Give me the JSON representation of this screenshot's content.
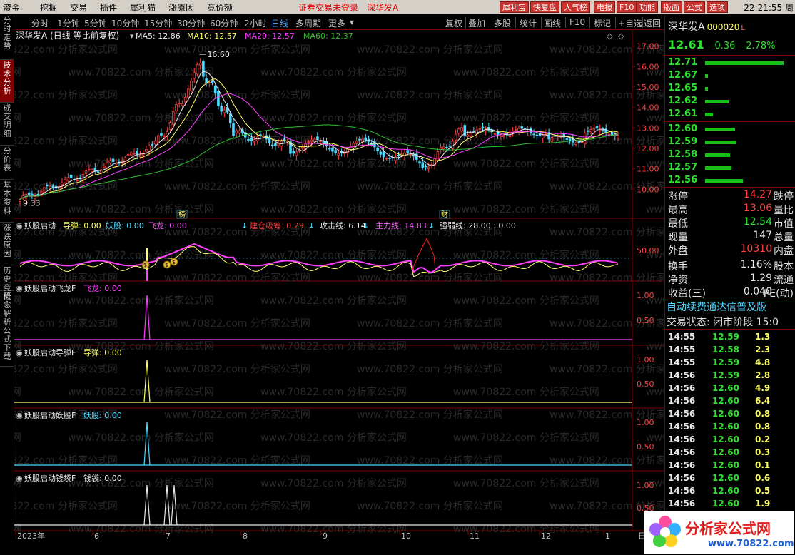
{
  "menu": {
    "items": [
      "资金",
      "挖掘",
      "交易",
      "插件",
      "犀利猫",
      "涨原因",
      "竞价额"
    ],
    "notice": "证券交易未登录",
    "notice_stock": "深华发A",
    "red_buttons": [
      "犀利宝",
      "快复盘",
      "人气榜",
      "电报",
      "F10",
      "功能",
      "版面",
      "公式",
      "选项"
    ],
    "clock": "22:21:55 周"
  },
  "periods": {
    "items": [
      "分时",
      "1分钟",
      "5分钟",
      "10分钟",
      "15分钟",
      "30分钟",
      "60分钟",
      "2小时",
      "日线",
      "多周期",
      "更多"
    ],
    "active": "日线",
    "tools": [
      "复权",
      "叠加",
      "多股",
      "统计",
      "画线",
      "F10",
      "标记",
      "+自选",
      "返回"
    ]
  },
  "left_tabs": [
    {
      "label": "分时走势",
      "active": false
    },
    {
      "label": "技术分析",
      "active": true
    },
    {
      "label": "成交明细",
      "active": false
    },
    {
      "label": "分价表",
      "active": false
    },
    {
      "label": "基本资料",
      "active": false
    },
    {
      "label": "涨跌原因",
      "active": false
    },
    {
      "label": "历史竞价",
      "active": false
    },
    {
      "label": "概念解析",
      "active": false
    },
    {
      "label": "公式下载",
      "active": false
    }
  ],
  "main_panel": {
    "title": "深华发A (日线 等比前复权)",
    "ma5": "MA5: 12.86",
    "ma10": "MA10: 12.57",
    "ma20": "MA20: 12.57",
    "ma60": "MA60: 12.37",
    "high_label": "16.60",
    "low_label": "9.33",
    "y_ticks": [
      "17.00",
      "16.00",
      "15.00",
      "14.00",
      "13.00",
      "12.00",
      "11.00",
      "10.00"
    ],
    "event_markers": [
      "榜",
      "财"
    ]
  },
  "indicator1": {
    "name": "妖股启动",
    "labels": [
      "导弹: 0.00",
      "妖股: 0.00",
      "飞龙: 0.00",
      "建仓吸筹: 0.29",
      "攻击线: 6.14",
      "主力线: 14.83",
      "强弱线: 28.00 : 0.00"
    ],
    "label_colors": [
      "#ffff66",
      "#4fd8ff",
      "#ff60ff",
      "#ff4040",
      "#e8e8e8",
      "#ff60ff",
      "#e8e8e8"
    ],
    "y_tick": "50.00",
    "signal_glyph": "$"
  },
  "sub_indicators": [
    {
      "name": "妖股启动飞龙F",
      "signal": "飞龙: 0.00",
      "color": "#ff40ff",
      "ticks": [
        "1.00",
        "0.50"
      ]
    },
    {
      "name": "妖股启动导弹F",
      "signal": "导弹: 0.00",
      "color": "#ffff66",
      "ticks": [
        "1.00",
        "0.50"
      ]
    },
    {
      "name": "妖股启动妖股F",
      "signal": "妖股: 0.00",
      "color": "#4fd8ff",
      "ticks": [
        "1.00",
        "0.50"
      ]
    },
    {
      "name": "妖股启动钱袋F",
      "signal": "钱袋: 0.00",
      "color": "#e8e8e8",
      "ticks": [
        "1.00",
        "0.50"
      ]
    }
  ],
  "x_axis": [
    "2023年",
    "6",
    "7",
    "8",
    "9",
    "10",
    "11",
    "12",
    "1"
  ],
  "x_axis_end": "日",
  "watermark": "www.70822.com 分析家公式网",
  "quote": {
    "name": "深华发A",
    "code": "000020",
    "mark": "L",
    "price": "12.61",
    "change": "-0.36",
    "pct": "-2.78%"
  },
  "orderbook": {
    "asks": [
      {
        "price": "12.71",
        "vol": 100
      },
      {
        "price": "12.67",
        "vol": 4
      },
      {
        "price": "12.65",
        "vol": 4
      },
      {
        "price": "12.62",
        "vol": 30
      },
      {
        "price": "12.61",
        "vol": 10
      }
    ],
    "bids": [
      {
        "price": "12.60",
        "vol": 38
      },
      {
        "price": "12.59",
        "vol": 40
      },
      {
        "price": "12.58",
        "vol": 32
      },
      {
        "price": "12.57",
        "vol": 34
      },
      {
        "price": "12.56",
        "vol": 48
      }
    ]
  },
  "stats": [
    {
      "label": "涨停",
      "value": "14.27",
      "label2": "跌停",
      "color": "#ff4040"
    },
    {
      "label": "最高",
      "value": "13.06",
      "label2": "量比",
      "color": "#ff4040"
    },
    {
      "label": "最低",
      "value": "12.54",
      "label2": "市值",
      "color": "#30e030"
    },
    {
      "label": "现量",
      "value": "147",
      "label2": "总量",
      "color": "#e8e8e8"
    },
    {
      "label": "外盘",
      "value": "10310",
      "label2": "内盘",
      "color": "#ff4040"
    },
    {
      "label": "换手",
      "value": "1.16%",
      "label2": "股本",
      "color": "#e8e8e8"
    },
    {
      "label": "净资",
      "value": "1.29",
      "label2": "流通",
      "color": "#e8e8e8"
    },
    {
      "label": "收益(三)",
      "value": "0.040",
      "label2": "PE(动)",
      "color": "#e8e8e8"
    }
  ],
  "banner": "自动续费通达信普及版",
  "trade_state": "交易状态: 闭市阶段 15:0",
  "ticks": [
    {
      "time": "14:55",
      "price": "12.59",
      "vol": "1.3",
      "color": "#30e030"
    },
    {
      "time": "14:55",
      "price": "12.58",
      "vol": "2.3",
      "color": "#30e030"
    },
    {
      "time": "14:55",
      "price": "12.59",
      "vol": "4.8",
      "color": "#30e030"
    },
    {
      "time": "14:56",
      "price": "12.59",
      "vol": "2.8",
      "color": "#30e030"
    },
    {
      "time": "14:56",
      "price": "12.60",
      "vol": "4.9",
      "color": "#30e030"
    },
    {
      "time": "14:56",
      "price": "12.60",
      "vol": "6.4",
      "color": "#30e030"
    },
    {
      "time": "14:56",
      "price": "12.60",
      "vol": "0.8",
      "color": "#30e030"
    },
    {
      "time": "14:56",
      "price": "12.60",
      "vol": "0.8",
      "color": "#30e030"
    },
    {
      "time": "14:56",
      "price": "12.60",
      "vol": "0.2",
      "color": "#30e030"
    },
    {
      "time": "14:56",
      "price": "12.60",
      "vol": "0.3",
      "color": "#30e030"
    },
    {
      "time": "14:56",
      "price": "12.60",
      "vol": "0.1",
      "color": "#30e030"
    },
    {
      "time": "14:56",
      "price": "12.60",
      "vol": "0.6",
      "color": "#30e030"
    },
    {
      "time": "14:56",
      "price": "12.60",
      "vol": "0.5",
      "color": "#30e030"
    },
    {
      "time": "14:56",
      "price": "12.60",
      "vol": "1.9",
      "color": "#30e030"
    }
  ],
  "logo": {
    "title": "分析家公式网",
    "url": "www.70822.com"
  },
  "colors": {
    "accent_red": "#800000",
    "up": "#ff4040",
    "down": "#30e030",
    "cyan": "#4fd8ff"
  }
}
